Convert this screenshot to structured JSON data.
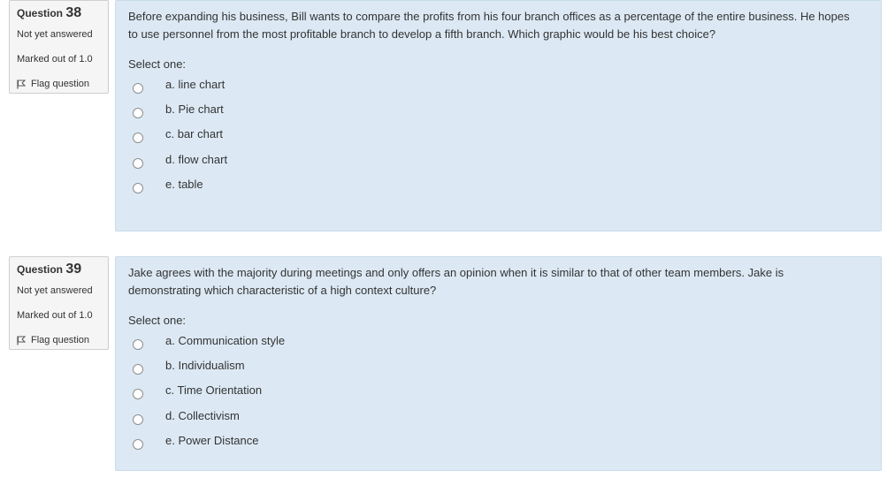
{
  "questions": [
    {
      "label": "Question",
      "number": "38",
      "state": "Not yet answered",
      "grade": "Marked out of 1.0",
      "flag_label": "Flag question",
      "text": "Before expanding his business, Bill wants to compare the profits from his four branch offices as a percentage of the entire business. He hopes to use personnel from the most profitable branch to develop a fifth branch. Which graphic would be his best choice?",
      "prompt": "Select one:",
      "options": [
        "a. line chart",
        "b. Pie chart",
        "c. bar chart",
        "d. flow chart",
        "e. table"
      ]
    },
    {
      "label": "Question",
      "number": "39",
      "state": "Not yet answered",
      "grade": "Marked out of 1.0",
      "flag_label": "Flag question",
      "text": "Jake agrees with the majority during meetings and only offers an opinion when it is similar to that of other team members. Jake is demonstrating which characteristic of a high context culture?",
      "prompt": "Select one:",
      "options": [
        "a. Communication style",
        "b. Individualism",
        "c. Time Orientation",
        "d. Collectivism",
        "e. Power Distance"
      ]
    }
  ],
  "colors": {
    "content_bg": "#dce9f4",
    "info_bg": "#f5f5f5",
    "text": "#333333"
  },
  "icons": {
    "flag": "flag-icon",
    "radio": "radio-unchecked"
  }
}
